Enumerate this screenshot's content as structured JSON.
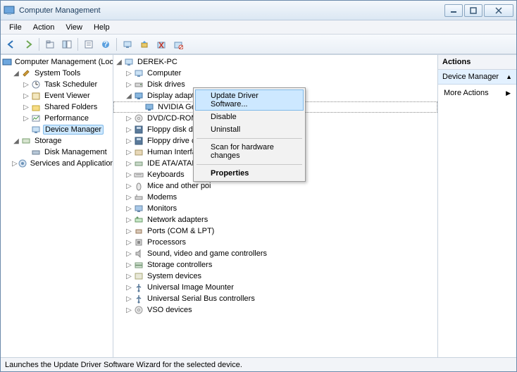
{
  "window": {
    "title": "Computer Management"
  },
  "menubar": [
    "File",
    "Action",
    "View",
    "Help"
  ],
  "left_tree": {
    "root": "Computer Management (Local",
    "system_tools": {
      "label": "System Tools",
      "children": [
        "Task Scheduler",
        "Event Viewer",
        "Shared Folders",
        "Performance",
        "Device Manager"
      ]
    },
    "storage": {
      "label": "Storage",
      "children": [
        "Disk Management"
      ]
    },
    "services": {
      "label": "Services and Applications"
    }
  },
  "device_tree": {
    "root": "DEREK-PC",
    "items": [
      {
        "label": "Computer",
        "exp": ">",
        "icon": "computer"
      },
      {
        "label": "Disk drives",
        "exp": ">",
        "icon": "disk"
      },
      {
        "label": "Display adapters",
        "exp": "v",
        "icon": "display",
        "children": [
          {
            "label": "NVIDIA GeForce 9600 GT",
            "icon": "display",
            "selected": true
          }
        ]
      },
      {
        "label": "DVD/CD-ROM driv",
        "exp": ">",
        "icon": "dvd"
      },
      {
        "label": "Floppy disk drives",
        "exp": ">",
        "icon": "floppy"
      },
      {
        "label": "Floppy drive contro",
        "exp": ">",
        "icon": "floppy"
      },
      {
        "label": "Human Interface D",
        "exp": ">",
        "icon": "hid"
      },
      {
        "label": "IDE ATA/ATAPI con",
        "exp": ">",
        "icon": "ide"
      },
      {
        "label": "Keyboards",
        "exp": ">",
        "icon": "keyboard"
      },
      {
        "label": "Mice and other poi",
        "exp": ">",
        "icon": "mouse"
      },
      {
        "label": "Modems",
        "exp": ">",
        "icon": "modem"
      },
      {
        "label": "Monitors",
        "exp": ">",
        "icon": "monitor"
      },
      {
        "label": "Network adapters",
        "exp": ">",
        "icon": "network"
      },
      {
        "label": "Ports (COM & LPT)",
        "exp": ">",
        "icon": "port"
      },
      {
        "label": "Processors",
        "exp": ">",
        "icon": "cpu"
      },
      {
        "label": "Sound, video and game controllers",
        "exp": ">",
        "icon": "sound"
      },
      {
        "label": "Storage controllers",
        "exp": ">",
        "icon": "storage"
      },
      {
        "label": "System devices",
        "exp": ">",
        "icon": "system"
      },
      {
        "label": "Universal Image Mounter",
        "exp": ">",
        "icon": "usb"
      },
      {
        "label": "Universal Serial Bus controllers",
        "exp": ">",
        "icon": "usb"
      },
      {
        "label": "VSO devices",
        "exp": ">",
        "icon": "dvd"
      }
    ]
  },
  "context_menu": {
    "items": [
      "Update Driver Software...",
      "Disable",
      "Uninstall",
      "Scan for hardware changes",
      "Properties"
    ],
    "hovered": 0,
    "bold": 4
  },
  "actions_pane": {
    "header": "Actions",
    "group": "Device Manager",
    "items": [
      "More Actions"
    ]
  },
  "statusbar": "Launches the Update Driver Software Wizard for the selected device."
}
